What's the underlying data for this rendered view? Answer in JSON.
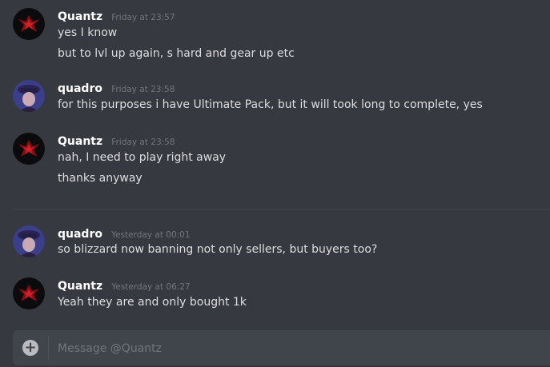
{
  "messages": [
    {
      "author": "Quantz",
      "timestamp": "Friday at 23:57",
      "lines": [
        "yes I know",
        "but to lvl up again, s hard and gear up etc"
      ]
    },
    {
      "author": "quadro",
      "timestamp": "Friday at 23:58",
      "lines": [
        "for this purposes i have Ultimate Pack, but it will took long to complete, yes"
      ]
    },
    {
      "author": "Quantz",
      "timestamp": "Friday at 23:58",
      "lines": [
        "nah, I need to play right away",
        "thanks anyway"
      ]
    },
    {
      "author": "quadro",
      "timestamp": "Yesterday at 00:01",
      "lines": [
        "so blizzard now banning not only sellers, but buyers too?"
      ]
    },
    {
      "author": "Quantz",
      "timestamp": "Yesterday at 06:27",
      "lines": [
        "Yeah they are and only bought 1k"
      ]
    }
  ],
  "composer": {
    "placeholder": "Message @Quantz",
    "add_icon": "plus-circle-icon"
  },
  "colors": {
    "background": "#36393f",
    "composer_bg": "#40444b",
    "author": "#ffffff",
    "timestamp": "#72767d",
    "text": "#dcddde"
  }
}
